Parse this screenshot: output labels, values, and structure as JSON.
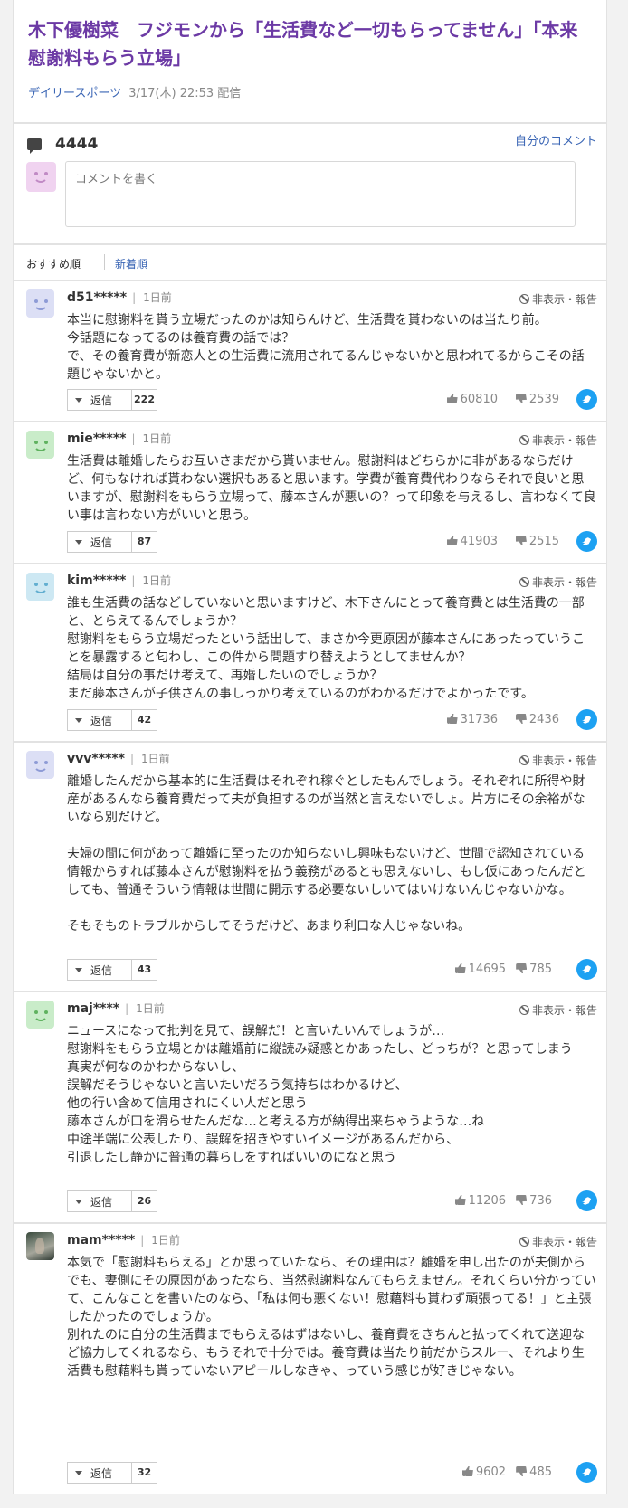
{
  "article": {
    "title": "木下優樹菜　フジモンから「生活費など一切もらってません」「本来慰謝料もらう立場」",
    "source": "デイリースポーツ",
    "datetime": "3/17(木) 22:53 配信"
  },
  "comment_box": {
    "count": "4444",
    "my_comment_label": "自分のコメント",
    "placeholder": "コメントを書く"
  },
  "sort": {
    "recommended": "おすすめ順",
    "newest": "新着順"
  },
  "labels": {
    "report": "非表示・報告",
    "reply": "返信"
  },
  "colors": {
    "title": "#6c3aa5",
    "link": "#3b66b5",
    "twitter": "#1da1f2"
  },
  "comments": [
    {
      "user": "d51*****",
      "date": "1日前",
      "avatar": "smiley-icon",
      "avatar_color": "#dcdff5",
      "face_color": "#8e9bd6",
      "body": "本当に慰謝料を貰う立場だったのかは知らんけど、生活費を貰わないのは当たり前。\n今話題になってるのは養育費の話では？\nで、その養育費が新恋人との生活費に流用されてるんじゃないかと思われてるからこその話題じゃないかと。",
      "replies": "222",
      "likes": "60810",
      "dislikes": "2539"
    },
    {
      "user": "mie*****",
      "date": "1日前",
      "avatar": "smiley-icon",
      "avatar_color": "#c9ecc9",
      "face_color": "#5fb25f",
      "body": "生活費は離婚したらお互いさまだから貰いません。慰謝料はどちらかに非があるならだけど、何もなければ貰わない選択もあると思います。学費が養育費代わりならそれで良いと思いますが、慰謝料をもらう立場って、藤本さんが悪いの？って印象を与えるし、言わなくて良い事は言わない方がいいと思う。",
      "replies": "87",
      "likes": "41903",
      "dislikes": "2515"
    },
    {
      "user": "kim*****",
      "date": "1日前",
      "avatar": "smiley-icon",
      "avatar_color": "#cde8f3",
      "face_color": "#62aed0",
      "body": "誰も生活費の話などしていないと思いますけど、木下さんにとって養育費とは生活費の一部と、とらえてるんでしょうか？\n慰謝料をもらう立場だったという話出して、まさか今更原因が藤本さんにあったっていうことを暴露すると匂わし、この件から問題すり替えようとしてませんか？\n結局は自分の事だけ考えて、再婚したいのでしょうか？\nまだ藤本さんが子供さんの事しっかり考えているのがわかるだけでよかったです。",
      "replies": "42",
      "likes": "31736",
      "dislikes": "2436"
    },
    {
      "user": "vvv*****",
      "date": "1日前",
      "avatar": "smiley-icon",
      "avatar_color": "#dcdff5",
      "face_color": "#8e9bd6",
      "body": "離婚したんだから基本的に生活費はそれぞれ稼ぐとしたもんでしょう。それぞれに所得や財産があるんなら養育費だって夫が負担するのが当然と言えないでしょ。片方にその余裕がないなら別だけど。\n\n夫婦の間に何があって離婚に至ったのか知らないし興味もないけど、世間で認知されている情報からすれば藤本さんが慰謝料を払う義務があるとも思えないし、もし仮にあったんだとしても、普通そういう情報は世間に開示する必要ないしいてはいけないんじゃないかな。\n\nそもそものトラブルからしてそうだけど、あまり利口な人じゃないね。",
      "replies": "43",
      "likes": "14695",
      "dislikes": "785"
    },
    {
      "user": "maj****",
      "date": "1日前",
      "avatar": "smiley-icon",
      "avatar_color": "#c9ecc9",
      "face_color": "#5fb25f",
      "body": "ニュースになって批判を見て、誤解だ！と言いたいんでしょうが…\n慰謝料をもらう立場とかは離婚前に縦読み疑惑とかあったし、どっちが？と思ってしまう\n真実が何なのかわからないし、\n誤解だそうじゃないと言いたいだろう気持ちはわかるけど、\n他の行い含めて信用されにくい人だと思う\n藤本さんが口を滑らせたんだな…と考える方が納得出来ちゃうような…ね\n中途半端に公表したり、誤解を招きやすいイメージがあるんだから、\n引退したし静かに普通の暮らしをすればいいのになと思う",
      "replies": "26",
      "likes": "11206",
      "dislikes": "736"
    },
    {
      "user": "mam*****",
      "date": "1日前",
      "avatar": "photo-avatar",
      "avatar_color": "#6f7a6c",
      "face_color": "#c8b9a8",
      "body": "本気で「慰謝料もらえる」とか思っていたなら、その理由は？離婚を申し出たのが夫側からでも、妻側にその原因があったなら、当然慰謝料なんてもらえません。それくらい分かっていて、こんなことを書いたのなら、「私は何も悪くない！慰藉料も貰わず頑張ってる！」と主張したかったのでしょうか。\n別れたのに自分の生活費までもらえるはずはないし、養育費をきちんと払ってくれて送迎など協力してくれるなら、もうそれで十分では。養育費は当たり前だからスルー、それより生活費も慰藉料も貰っていないアピールしなきゃ、っていう感じが好きじゃない。",
      "replies": "32",
      "likes": "9602",
      "dislikes": "485"
    }
  ]
}
